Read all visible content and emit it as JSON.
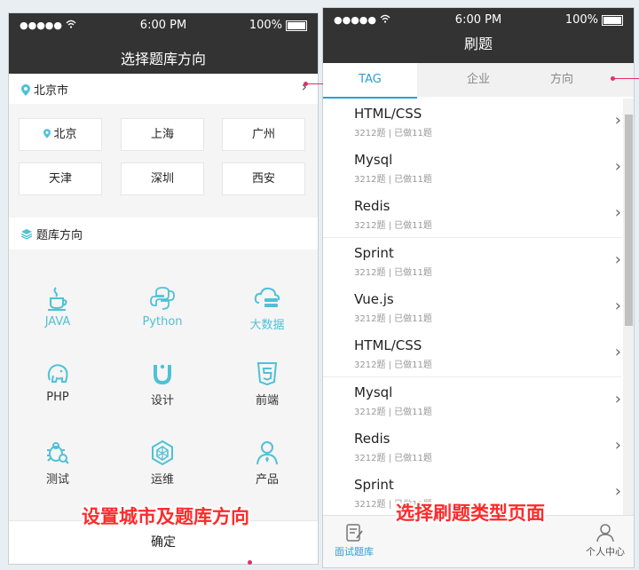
{
  "left_phone": {
    "status": {
      "signal": "●●●●● ",
      "time": "6:00 PM",
      "battery": "100%"
    },
    "title": "选择题库方向",
    "current_city": "北京市",
    "cities": [
      "北京",
      "上海",
      "广州",
      "天津",
      "深圳",
      "西安"
    ],
    "direction_header": "题库方向",
    "categories": [
      {
        "label": "JAVA",
        "icon": "java-cup-icon",
        "highlight": true
      },
      {
        "label": "Python",
        "icon": "python-icon",
        "highlight": true
      },
      {
        "label": "大数据",
        "icon": "bigdata-icon",
        "highlight": true
      },
      {
        "label": "PHP",
        "icon": "php-elephant-icon",
        "highlight": false
      },
      {
        "label": "设计",
        "icon": "design-magnet-icon",
        "highlight": false
      },
      {
        "label": "前端",
        "icon": "html5-icon",
        "highlight": false
      },
      {
        "label": "测试",
        "icon": "bug-icon",
        "highlight": false
      },
      {
        "label": "运维",
        "icon": "ops-hex-icon",
        "highlight": false
      },
      {
        "label": "产品",
        "icon": "product-person-icon",
        "highlight": false
      }
    ],
    "confirm": "确定"
  },
  "right_phone": {
    "status": {
      "signal": "●●●●● ",
      "time": "6:00 PM",
      "battery": "100%"
    },
    "title": "刷题",
    "tabs": [
      "TAG",
      "企业",
      "方向"
    ],
    "items": [
      {
        "name": "HTML/CSS",
        "meta": "3212题 | 已做11题"
      },
      {
        "name": "Mysql",
        "meta": "3212题 | 已做11题"
      },
      {
        "name": "Redis",
        "meta": "3212题 | 已做11题"
      },
      {
        "name": "Sprint",
        "meta": "3212题 | 已做11题"
      },
      {
        "name": "Vue.js",
        "meta": "3212题 | 已做11题"
      },
      {
        "name": "HTML/CSS",
        "meta": "3212题 | 已做11题"
      },
      {
        "name": "Mysql",
        "meta": "3212题 | 已做11题"
      },
      {
        "name": "Redis",
        "meta": "3212题 | 已做11题"
      },
      {
        "name": "Sprint",
        "meta": "3212题 | 已做11题"
      }
    ],
    "bottom_tabs": [
      "面试题库",
      "个人中心"
    ]
  },
  "captions": {
    "left": "设置城市及题库方向",
    "right": "选择刷题类型页面"
  },
  "colors": {
    "accent": "#2a9ed8",
    "teal": "#4fc1d6",
    "annotation": "#e0306a",
    "caption": "#ff2a2a",
    "bar": "#333333"
  }
}
